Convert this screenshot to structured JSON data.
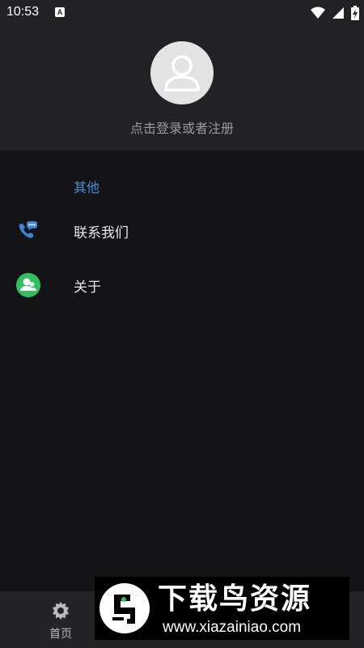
{
  "status_bar": {
    "time": "10:53",
    "notification_badge": "A",
    "icons": [
      "wifi-icon",
      "cellular-signal-icon",
      "battery-charging-icon"
    ]
  },
  "profile": {
    "avatar_icon": "user-avatar-icon",
    "login_prompt": "点击登录或者注册"
  },
  "menu": {
    "section_title": "其他",
    "items": [
      {
        "label": "联系我们",
        "icon": "phone-chat-icon",
        "icon_color": "#3a86d8"
      },
      {
        "label": "关于",
        "icon": "contacts-icon",
        "icon_color": "#2fbf5f"
      }
    ]
  },
  "bottom_nav": {
    "home_label": "首页",
    "home_icon": "gear-icon"
  },
  "watermark": {
    "title": "下载鸟资源",
    "url": "www.xiazainiao.com"
  },
  "colors": {
    "background": "#141416",
    "header": "#222225",
    "accent": "#4a90d9"
  }
}
